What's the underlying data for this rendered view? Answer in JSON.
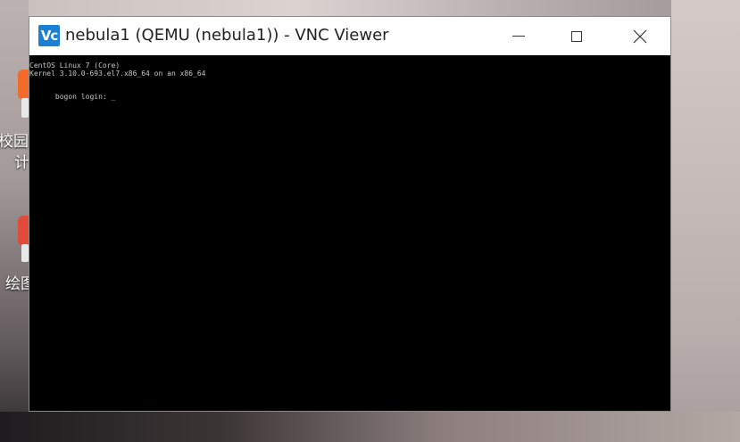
{
  "desktop": {
    "icons": [
      {
        "label": "校园",
        "label2": "计",
        "color": "#f26b2a"
      },
      {
        "label": "绘图",
        "color": "#e04b3b"
      }
    ]
  },
  "window": {
    "title": "nebula1 (QEMU (nebula1)) - VNC Viewer",
    "app_icon_text": "Vc",
    "controls": {
      "minimize": "minimize",
      "maximize": "maximize",
      "close": "close"
    }
  },
  "terminal": {
    "lines": [
      "CentOS Linux 7 (Core)",
      "Kernel 3.10.0-693.el7.x86_64 on an x86_64",
      "",
      "bogon login: "
    ],
    "cursor": "_"
  }
}
